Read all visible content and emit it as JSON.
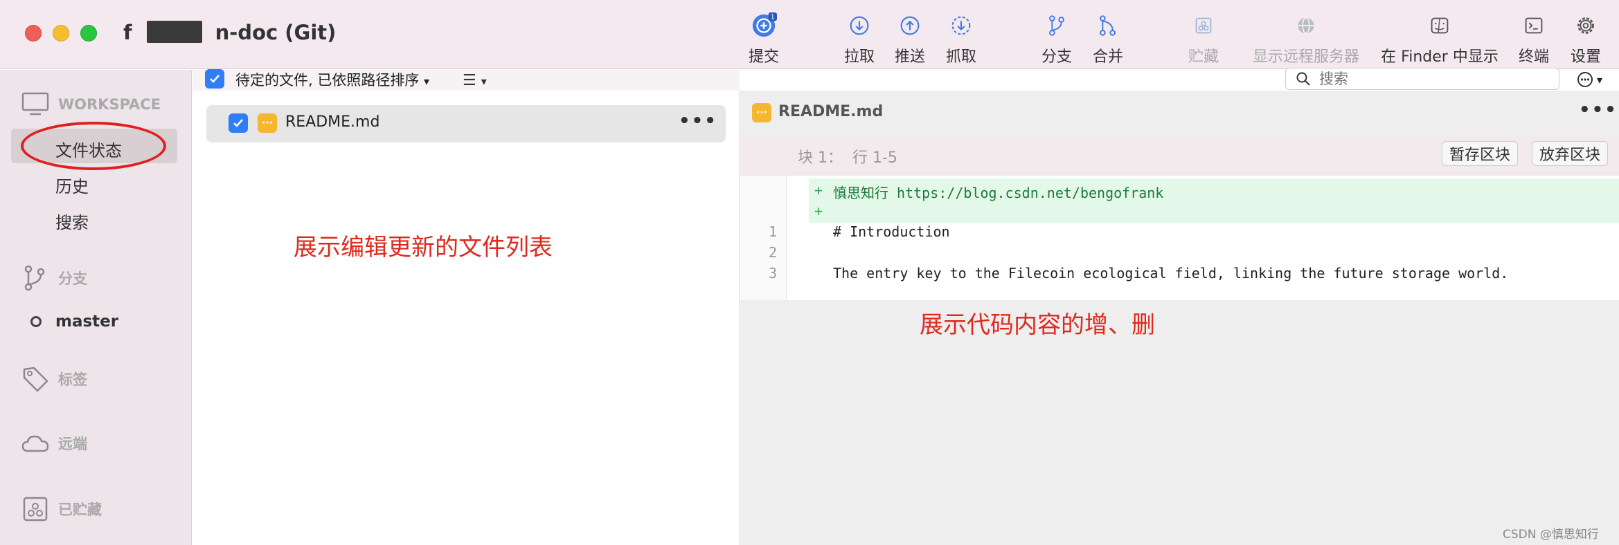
{
  "window": {
    "title_prefix": "f",
    "title_suffix": "n-doc (Git)"
  },
  "toolbar": {
    "commit": {
      "label": "提交",
      "badge": "1"
    },
    "pull": {
      "label": "拉取"
    },
    "push": {
      "label": "推送"
    },
    "fetch": {
      "label": "抓取"
    },
    "branch": {
      "label": "分支"
    },
    "merge": {
      "label": "合并"
    },
    "stash": {
      "label": "贮藏"
    },
    "show_remote": {
      "label": "显示远程服务器"
    },
    "show_finder": {
      "label": "在 Finder 中显示"
    },
    "terminal": {
      "label": "终端"
    },
    "settings": {
      "label": "设置"
    }
  },
  "sidebar": {
    "workspace_header": "WORKSPACE",
    "workspace_items": [
      "文件状态",
      "历史",
      "搜索"
    ],
    "branches_header": "分支",
    "current_branch": "master",
    "tags_header": "标签",
    "remotes_header": "远端",
    "stashes_header": "已贮藏"
  },
  "file_list": {
    "header_label": "待定的文件, 已依照路径排序",
    "files": [
      {
        "name": "README.md",
        "checked": true
      }
    ]
  },
  "search": {
    "placeholder": "搜索"
  },
  "diff": {
    "file_name": "README.md",
    "hunk_label": "块 1：  行 1-5",
    "stage_hunk": "暂存区块",
    "discard_hunk": "放弃区块",
    "lines": [
      {
        "type": "add",
        "marker": "+",
        "old": "",
        "text": "慎思知行 https://blog.csdn.net/bengofrank"
      },
      {
        "type": "add",
        "marker": "+",
        "old": "",
        "text": ""
      },
      {
        "type": "ctx",
        "marker": "",
        "old": "1",
        "text": "# Introduction"
      },
      {
        "type": "ctx",
        "marker": "",
        "old": "2",
        "text": ""
      },
      {
        "type": "ctx",
        "marker": "",
        "old": "3",
        "text": "The entry key to the Filecoin ecological field, linking the future storage world."
      }
    ]
  },
  "annotations": {
    "file_list_note": "展示编辑更新的文件列表",
    "diff_note": "展示代码内容的增、删"
  },
  "watermark": "CSDN @慎思知行",
  "colors": {
    "accent": "#2f7ef5",
    "modified": "#f5b731",
    "annotation": "#e0281e",
    "added_bg": "#e3f8e8"
  }
}
